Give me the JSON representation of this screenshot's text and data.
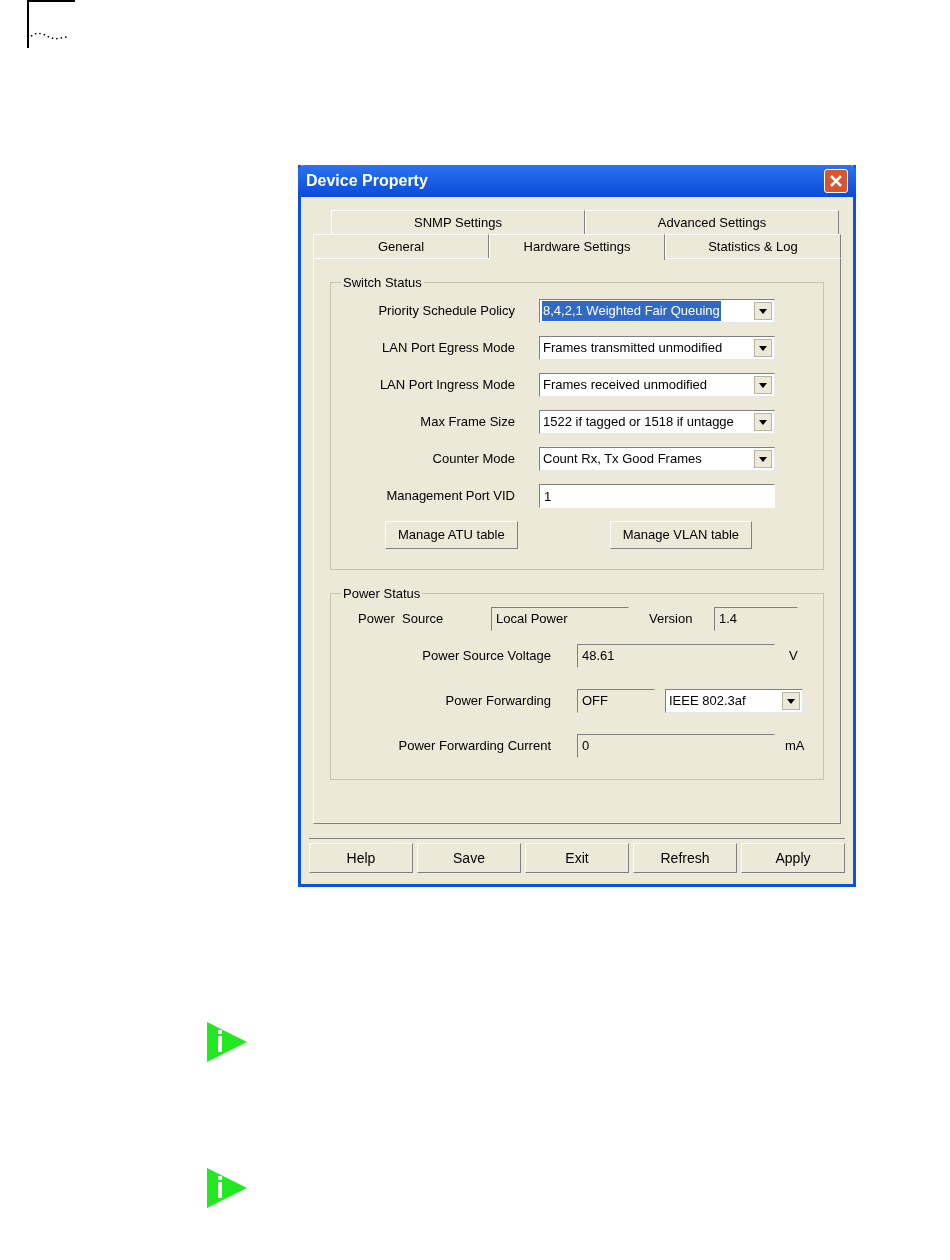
{
  "window": {
    "title": "Device Property"
  },
  "tab_rows": [
    [
      {
        "label": "SNMP Settings",
        "selected": false
      },
      {
        "label": "Advanced Settings",
        "selected": false
      }
    ],
    [
      {
        "label": "General",
        "selected": false
      },
      {
        "label": "Hardware Settings",
        "selected": true
      },
      {
        "label": "Statistics & Log",
        "selected": false
      }
    ]
  ],
  "switch_status": {
    "title": "Switch Status",
    "fields": [
      {
        "label": "Priority Schedule Policy",
        "kind": "dropdown",
        "value": "8,4,2,1 Weighted Fair Queuing",
        "focused": true
      },
      {
        "label": "LAN Port Egress Mode",
        "kind": "dropdown",
        "value": "Frames transmitted unmodified",
        "focused": false
      },
      {
        "label": "LAN Port Ingress Mode",
        "kind": "dropdown",
        "value": "Frames received unmodified",
        "focused": false
      },
      {
        "label": "Max Frame Size",
        "kind": "dropdown",
        "value": "1522 if tagged or 1518 if untagge",
        "focused": false
      },
      {
        "label": "Counter Mode",
        "kind": "dropdown",
        "value": "Count Rx, Tx Good Frames",
        "focused": false
      },
      {
        "label": "Management Port VID",
        "kind": "text",
        "value": "1",
        "focused": false
      }
    ],
    "buttons": [
      "Manage ATU table",
      "Manage VLAN table"
    ]
  },
  "power_status": {
    "title": "Power Status",
    "source": {
      "label": "Power  Source",
      "value": "Local Power"
    },
    "version": {
      "label": "Version",
      "value": "1.4"
    },
    "voltage": {
      "label": "Power Source Voltage",
      "value": "48.61",
      "unit": "V"
    },
    "forwarding": {
      "label": "Power Forwarding",
      "value": "OFF",
      "standard": "IEEE 802.3af"
    },
    "current": {
      "label": "Power Forwarding Current",
      "value": "0",
      "unit": "mA"
    }
  },
  "footer_buttons": [
    "Help",
    "Save",
    "Exit",
    "Refresh",
    "Apply"
  ]
}
